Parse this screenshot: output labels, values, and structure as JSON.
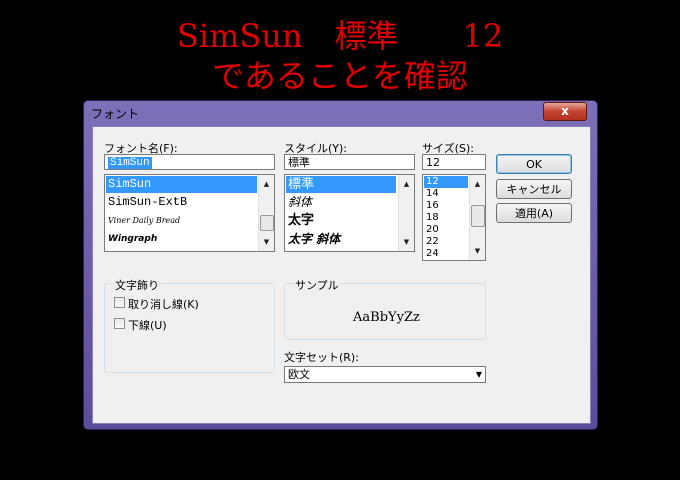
{
  "caption": {
    "line1": "SimSun　標準　　12",
    "line2": "であることを確認"
  },
  "dialog": {
    "title": "フォント",
    "close_glyph": "x",
    "font": {
      "label": "フォント名(F):",
      "value": "SimSun",
      "items": [
        "SimSun",
        "SimSun-ExtB",
        "Viner Daily Bread",
        "Wingraph"
      ]
    },
    "style": {
      "label": "スタイル(Y):",
      "value": "標準",
      "items": [
        "標準",
        "斜体",
        "太字",
        "太字 斜体"
      ]
    },
    "size": {
      "label": "サイズ(S):",
      "value": "12",
      "items": [
        "12",
        "14",
        "16",
        "18",
        "20",
        "22",
        "24"
      ]
    },
    "buttons": {
      "ok": "OK",
      "cancel": "キャンセル",
      "apply": "適用(A)"
    },
    "effects": {
      "label": "文字飾り",
      "strikeout": "取り消し線(K)",
      "underline": "下線(U)"
    },
    "sample": {
      "label": "サンプル",
      "text": "AaBbYyZz"
    },
    "charset": {
      "label": "文字セット(R):",
      "value": "欧文"
    }
  }
}
